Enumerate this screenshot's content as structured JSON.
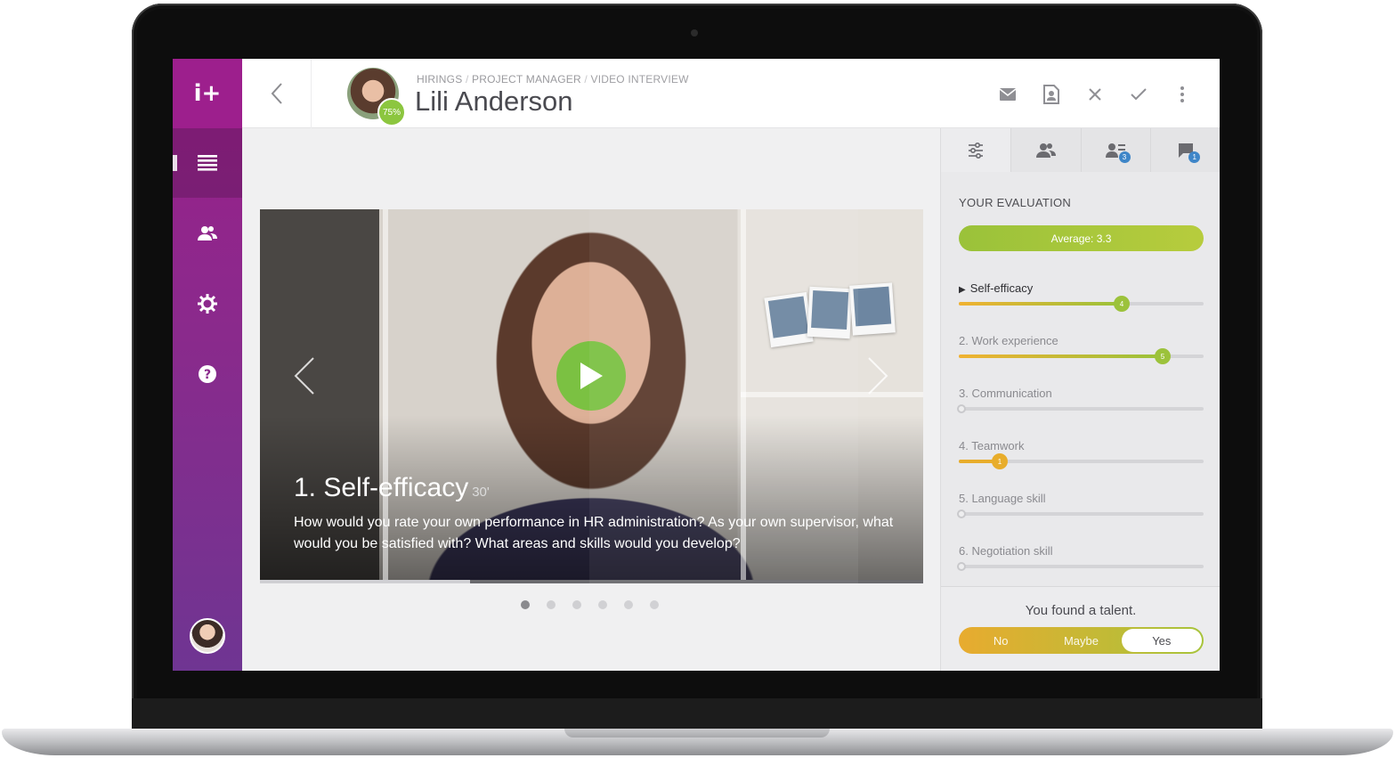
{
  "app": {
    "logo_text": "i+"
  },
  "sidebar": {
    "items": [
      {
        "icon": "list-icon",
        "active": true
      },
      {
        "icon": "people-icon",
        "active": false
      },
      {
        "icon": "gear-icon",
        "active": false
      },
      {
        "icon": "help-icon",
        "active": false
      }
    ]
  },
  "header": {
    "breadcrumb": [
      "HIRINGS",
      "PROJECT MANAGER",
      "VIDEO INTERVIEW"
    ],
    "breadcrumb_separator": "/",
    "candidate_name": "Lili Anderson",
    "match_score": "75%",
    "actions": [
      "mail-icon",
      "save-icon",
      "close-icon",
      "check-icon",
      "more-icon"
    ]
  },
  "video": {
    "question_title": "1. Self-efficacy",
    "duration": "30'",
    "question_text": "How would you rate your own performance in HR administration? As your own supervisor, what would you be satisfied with? What areas and skills would you develop?",
    "progress": 0.317,
    "total_questions": 6,
    "current_question": 1
  },
  "panel": {
    "tabs": [
      {
        "icon": "sliders-icon",
        "badge": ""
      },
      {
        "icon": "group-icon",
        "badge": ""
      },
      {
        "icon": "reviewers-icon",
        "badge": "3"
      },
      {
        "icon": "comment-icon",
        "badge": "1"
      }
    ],
    "heading": "YOUR EVALUATION",
    "average_label": "Average: 3.3",
    "criteria": [
      {
        "label": "Self-efficacy",
        "marker": "▶",
        "value": 4,
        "max": 6,
        "active": true
      },
      {
        "label": "2. Work experience",
        "value": 5,
        "max": 6,
        "active": false
      },
      {
        "label": "3. Communication",
        "value": 0,
        "max": 6,
        "active": false
      },
      {
        "label": "4. Teamwork",
        "value": 1,
        "max": 6,
        "active": false
      },
      {
        "label": "5. Language skill",
        "value": 0,
        "max": 6,
        "active": false
      },
      {
        "label": "6. Negotiation skill",
        "value": 0,
        "max": 6,
        "active": false
      }
    ],
    "talent": {
      "title": "You found a talent.",
      "options": [
        "No",
        "Maybe",
        "Yes"
      ],
      "selected": "Yes"
    }
  }
}
